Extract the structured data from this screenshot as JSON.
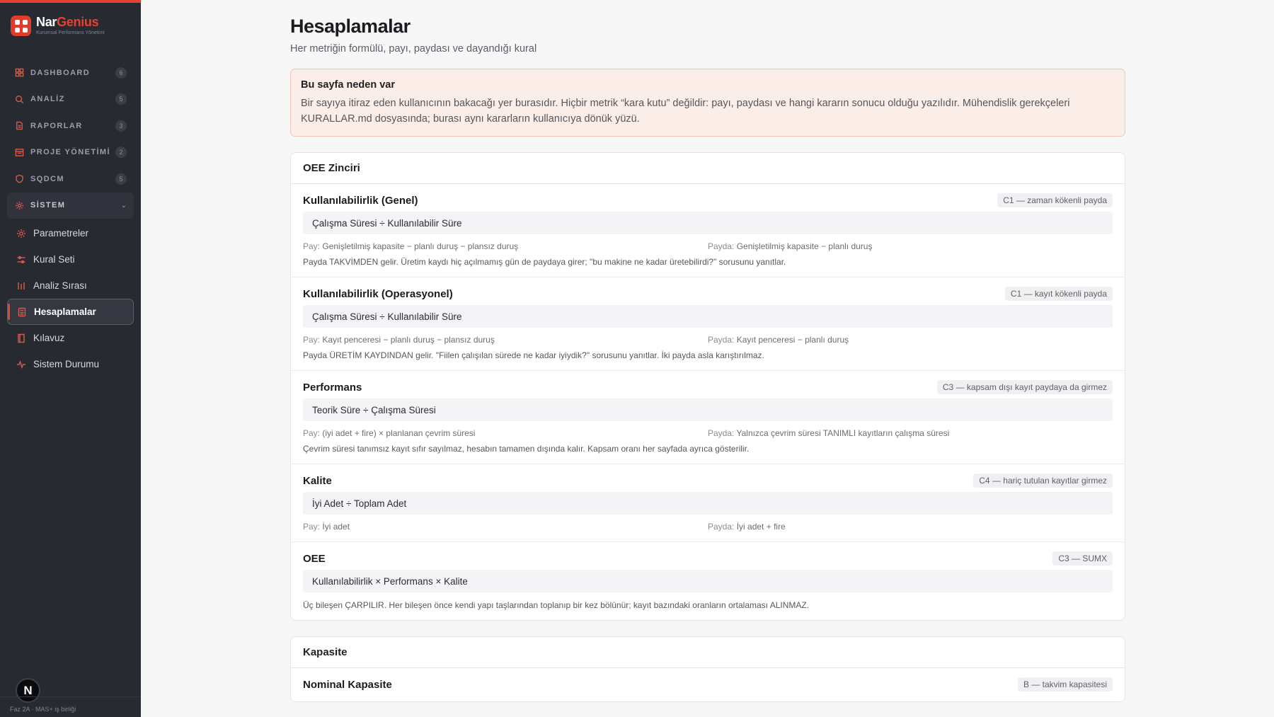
{
  "brand": {
    "name_a": "Nar",
    "name_b": "Genius",
    "subtitle": "Kurumsal Performans Yönetimi"
  },
  "nav": [
    {
      "label": "DASHBOARD",
      "count": "6",
      "icon": "dashboard-icon"
    },
    {
      "label": "ANALİZ",
      "count": "5",
      "icon": "search-icon"
    },
    {
      "label": "RAPORLAR",
      "count": "3",
      "icon": "report-icon"
    },
    {
      "label": "PROJE YÖNETİMİ",
      "count": "2",
      "icon": "project-icon"
    },
    {
      "label": "SQDCM",
      "count": "5",
      "icon": "shield-icon"
    }
  ],
  "system_group": {
    "label": "SİSTEM",
    "icon": "gear-icon",
    "chevron": "chevron-down-icon"
  },
  "system_items": [
    {
      "label": "Parametreler",
      "icon": "gear-icon"
    },
    {
      "label": "Kural Seti",
      "icon": "sliders-icon"
    },
    {
      "label": "Analiz Sırası",
      "icon": "bars-icon"
    },
    {
      "label": "Hesaplamalar",
      "icon": "calculator-icon",
      "active": true
    },
    {
      "label": "Kılavuz",
      "icon": "book-icon"
    },
    {
      "label": "Sistem Durumu",
      "icon": "pulse-icon"
    }
  ],
  "avatar": "N",
  "footer": "Faz 2A · MAS+ iş birliği",
  "page": {
    "title": "Hesaplamalar",
    "subtitle": "Her metriğin formülü, payı, paydası ve dayandığı kural"
  },
  "alert": {
    "title": "Bu sayfa neden var",
    "body": "Bir sayıya itiraz eden kullanıcının bakacağı yer burasıdır. Hiçbir metrik “kara kutu” değildir: payı, paydası ve hangi kararın sonucu olduğu yazılıdır. Mühendislik gerekçeleri KURALLAR.md dosyasında; burası aynı kararların kullanıcıya dönük yüzü."
  },
  "sections": [
    {
      "title": "OEE Zinciri",
      "metrics": [
        {
          "name": "Kullanılabilirlik (Genel)",
          "tag": "C1 — zaman kökenli payda",
          "formula": "Çalışma Süresi ÷ Kullanılabilir Süre",
          "pay_key": "Pay:",
          "pay": "Genişletilmiş kapasite − planlı duruş − plansız duruş",
          "payda_key": "Payda:",
          "payda": "Genişletilmiş kapasite − planlı duruş",
          "note": "Payda TAKVİMDEN gelir. Üretim kaydı hiç açılmamış gün de paydaya girer; \"bu makine ne kadar üretebilirdi?\" sorusunu yanıtlar."
        },
        {
          "name": "Kullanılabilirlik (Operasyonel)",
          "tag": "C1 — kayıt kökenli payda",
          "formula": "Çalışma Süresi ÷ Kullanılabilir Süre",
          "pay_key": "Pay:",
          "pay": "Kayıt penceresi − planlı duruş − plansız duruş",
          "payda_key": "Payda:",
          "payda": "Kayıt penceresi − planlı duruş",
          "note": "Payda ÜRETİM KAYDINDAN gelir. \"Fiilen çalışılan sürede ne kadar iyiydik?\" sorusunu yanıtlar. İki payda asla karıştırılmaz."
        },
        {
          "name": "Performans",
          "tag": "C3 — kapsam dışı kayıt paydaya da girmez",
          "formula": "Teorik Süre ÷ Çalışma Süresi",
          "pay_key": "Pay:",
          "pay": "(iyi adet + fire) × planlanan çevrim süresi",
          "payda_key": "Payda:",
          "payda": "Yalnızca çevrim süresi TANIMLI kayıtların çalışma süresi",
          "note": "Çevrim süresi tanımsız kayıt sıfır sayılmaz, hesabın tamamen dışında kalır. Kapsam oranı her sayfada ayrıca gösterilir."
        },
        {
          "name": "Kalite",
          "tag": "C4 — hariç tutulan kayıtlar girmez",
          "formula": "İyi Adet ÷ Toplam Adet",
          "pay_key": "Pay:",
          "pay": "İyi adet",
          "payda_key": "Payda:",
          "payda": "İyi adet + fire",
          "note": ""
        },
        {
          "name": "OEE",
          "tag": "C3 — SUMX",
          "formula": "Kullanılabilirlik × Performans × Kalite",
          "note": "Üç bileşen ÇARPILIR. Her bileşen önce kendi yapı taşlarından toplanıp bir kez bölünür; kayıt bazındaki oranların ortalaması ALINMAZ."
        }
      ]
    },
    {
      "title": "Kapasite",
      "metrics": [
        {
          "name": "Nominal Kapasite",
          "tag": "B — takvim kapasitesi"
        }
      ]
    }
  ]
}
